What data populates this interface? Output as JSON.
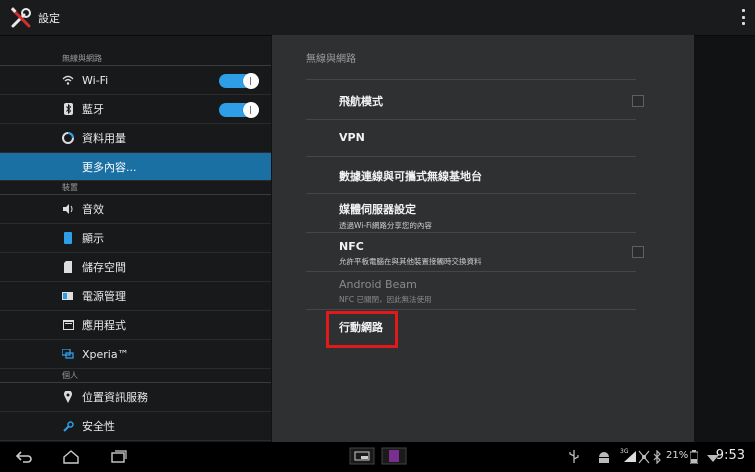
{
  "app": {
    "title": "設定",
    "icon": "tools-icon"
  },
  "sidebar": {
    "categories": [
      "無線與網路",
      "裝置",
      "個人"
    ],
    "items": [
      {
        "label": "Wi-Fi",
        "icon": "wifi-icon",
        "toggle": true
      },
      {
        "label": "藍牙",
        "icon": "bluetooth-icon",
        "toggle": true
      },
      {
        "label": "資料用量",
        "icon": "data-usage-icon"
      },
      {
        "label": "更多內容...",
        "icon": "",
        "selected": true
      },
      {
        "label": "音效",
        "icon": "sound-icon"
      },
      {
        "label": "顯示",
        "icon": "display-icon"
      },
      {
        "label": "儲存空間",
        "icon": "storage-icon"
      },
      {
        "label": "電源管理",
        "icon": "battery-icon"
      },
      {
        "label": "應用程式",
        "icon": "apps-icon"
      },
      {
        "label": "Xperia™",
        "icon": "xperia-icon"
      },
      {
        "label": "位置資訊服務",
        "icon": "location-icon"
      },
      {
        "label": "安全性",
        "icon": "security-icon"
      }
    ]
  },
  "main": {
    "header": "無線與網路",
    "rows": [
      {
        "title": "飛航模式",
        "checkbox": true
      },
      {
        "title": "VPN"
      },
      {
        "title": "數據連線與可攜式無線基地台"
      },
      {
        "title": "媒體伺服器設定",
        "summary": "透過Wi-Fi網路分享您的內容"
      },
      {
        "title": "NFC",
        "summary": "允許平板電腦在與其他裝置接觸時交換資料",
        "checkbox": true
      },
      {
        "title": "Android Beam",
        "summary": "NFC 已關閉，因此無法使用",
        "disabled": true
      },
      {
        "title": "行動網路",
        "highlighted": true
      }
    ]
  },
  "statusbar": {
    "battery_percent": "21%",
    "time": "9:53",
    "network": "3G",
    "colors": {
      "accent": "#1a6fa3",
      "toggle_on": "#2e9ee6",
      "highlight": "#e01a1a"
    }
  }
}
